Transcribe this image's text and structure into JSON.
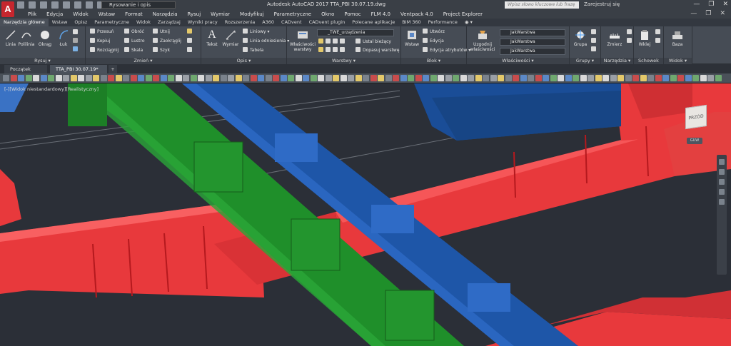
{
  "titlebar": {
    "workspace": "Rysowanie i opis",
    "title": "Autodesk AutoCAD 2017    TTA_PBI 30.07.19.dwg",
    "search_placeholder": "Wpisz słowo kluczowe lub frazę",
    "signin": "Zarejestruj się"
  },
  "menu": [
    "Plik",
    "Edycja",
    "Widok",
    "Wstaw",
    "Format",
    "Narzędzia",
    "Rysuj",
    "Wymiar",
    "Modyfikuj",
    "Parametryczne",
    "Okno",
    "Pomoc",
    "FLM 4.0",
    "Ventpack 4.0",
    "Project Explorer"
  ],
  "ribbon_tabs": [
    "Narzędzia główne",
    "Wstaw",
    "Opisz",
    "Parametryczne",
    "Widok",
    "Zarządzaj",
    "Wyniki pracy",
    "Rozszerzenia",
    "A360",
    "CADvent",
    "CADvent plugin",
    "Polecane aplikacje",
    "BIM 360",
    "Performance"
  ],
  "panels": {
    "rysuj": {
      "title": "Rysuj ▾",
      "tools": [
        "Linia",
        "Polilinia",
        "Okrąg",
        "Łuk"
      ]
    },
    "zmien": {
      "title": "Zmień ▾",
      "tools": [
        "Przesuń",
        "Obróć",
        "Utnij",
        "Kopiuj",
        "Lustro",
        "Zaokrąglij",
        "Rozciągnij",
        "Skala",
        "Szyk"
      ]
    },
    "opis": {
      "title": "Opis ▾",
      "tools": [
        "Tekst",
        "Wymiar",
        "Liniowy",
        "Linia odniesienia",
        "Tabela"
      ]
    },
    "warstwy": {
      "title": "Warstwy ▾",
      "big": "Właściwości warstwy",
      "layer": "_TWE_urządzenia",
      "tools": [
        "Ustal bieżący",
        "Dopasuj warstwę"
      ]
    },
    "blok": {
      "title": "Blok ▾",
      "big": "Wstaw",
      "tools": [
        "Utwórz",
        "Edycja",
        "Edycja atrybutów"
      ]
    },
    "wlasciwosci": {
      "title": "Właściwości ▾",
      "big": "Uzgodnij właściwości",
      "values": [
        "JakWarstwa",
        "JakWarstwa",
        "JakWarstwa"
      ]
    },
    "grupy": {
      "title": "Grupy ▾",
      "big": "Grupa"
    },
    "narzedzia": {
      "title": "Narzędzia ▾",
      "big": "Zmierz"
    },
    "schowek": {
      "title": "Schowek",
      "big": "Wklej"
    },
    "widok": {
      "title": "Widok ▾",
      "big": "Baza"
    }
  },
  "file_tabs": [
    "Początek",
    "TTA_PBI 30.07.19*"
  ],
  "viewport_label": "[-][Widok niestandardowy][Realistyczny]",
  "viewcube": {
    "face": "PRZÓD",
    "wcs": "GUW"
  },
  "colors": {
    "red_duct": "#e8393c",
    "green_duct": "#1f8f2a",
    "blue_duct": "#1e56a8",
    "background": "#2b2f37"
  }
}
